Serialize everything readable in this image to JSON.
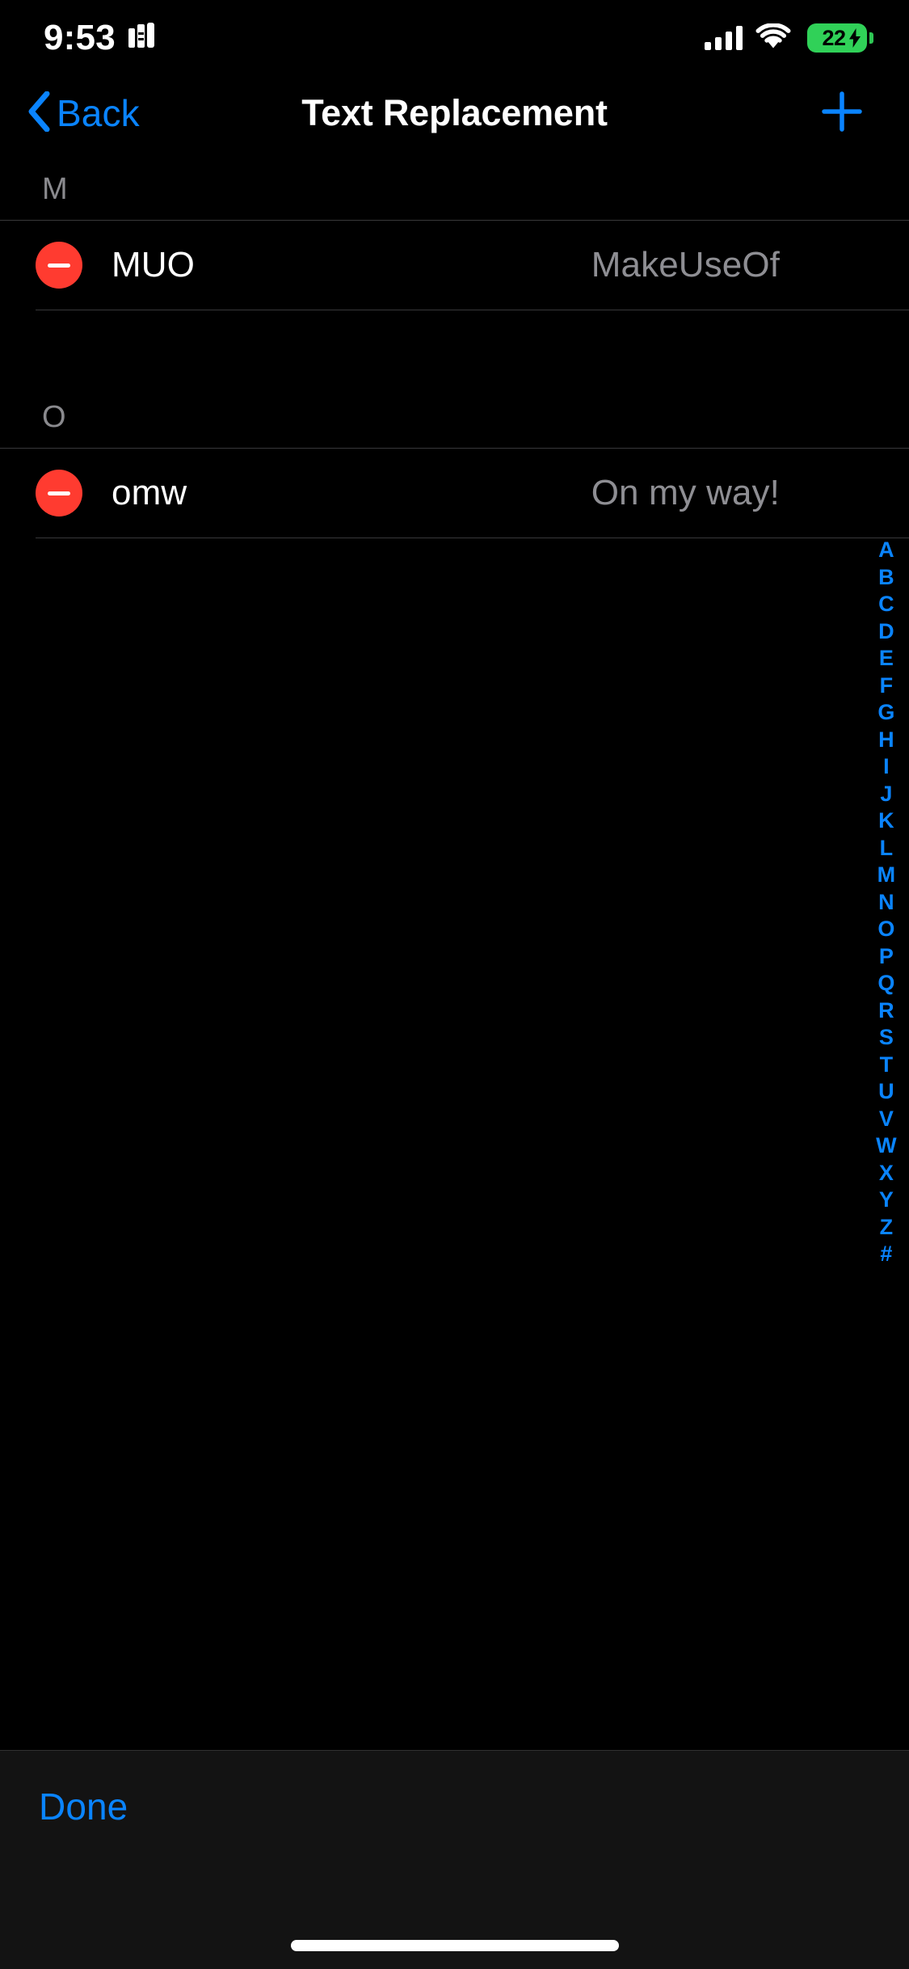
{
  "status_bar": {
    "time": "9:53",
    "left_icon": "audio-bars-icon",
    "cellular_icon": "cellular-signal-icon",
    "cellular_bars": 4,
    "wifi_icon": "wifi-icon",
    "battery_icon": "battery-charging-icon",
    "battery_level": "22",
    "battery_charging": true,
    "battery_color": "#30d158"
  },
  "nav": {
    "back_label": "Back",
    "back_icon": "chevron-left-icon",
    "title": "Text Replacement",
    "add_icon": "plus-icon",
    "accent_color": "#0a84ff"
  },
  "sections": [
    {
      "header": "M",
      "rows": [
        {
          "delete_icon": "minus-circle-icon",
          "shortcut": "MUO",
          "phrase": "MakeUseOf"
        }
      ]
    },
    {
      "header": "O",
      "rows": [
        {
          "delete_icon": "minus-circle-icon",
          "shortcut": "omw",
          "phrase": "On my way!"
        }
      ]
    }
  ],
  "index_bar": {
    "letters": [
      "A",
      "B",
      "C",
      "D",
      "E",
      "F",
      "G",
      "H",
      "I",
      "J",
      "K",
      "L",
      "M",
      "N",
      "O",
      "P",
      "Q",
      "R",
      "S",
      "T",
      "U",
      "V",
      "W",
      "X",
      "Y",
      "Z",
      "#"
    ]
  },
  "toolbar": {
    "done_label": "Done"
  },
  "colors": {
    "background": "#000000",
    "accent": "#0a84ff",
    "destructive": "#ff3b30",
    "secondary_text": "#8e8e93",
    "separator": "#38383a",
    "toolbar_bg": "#131313"
  }
}
